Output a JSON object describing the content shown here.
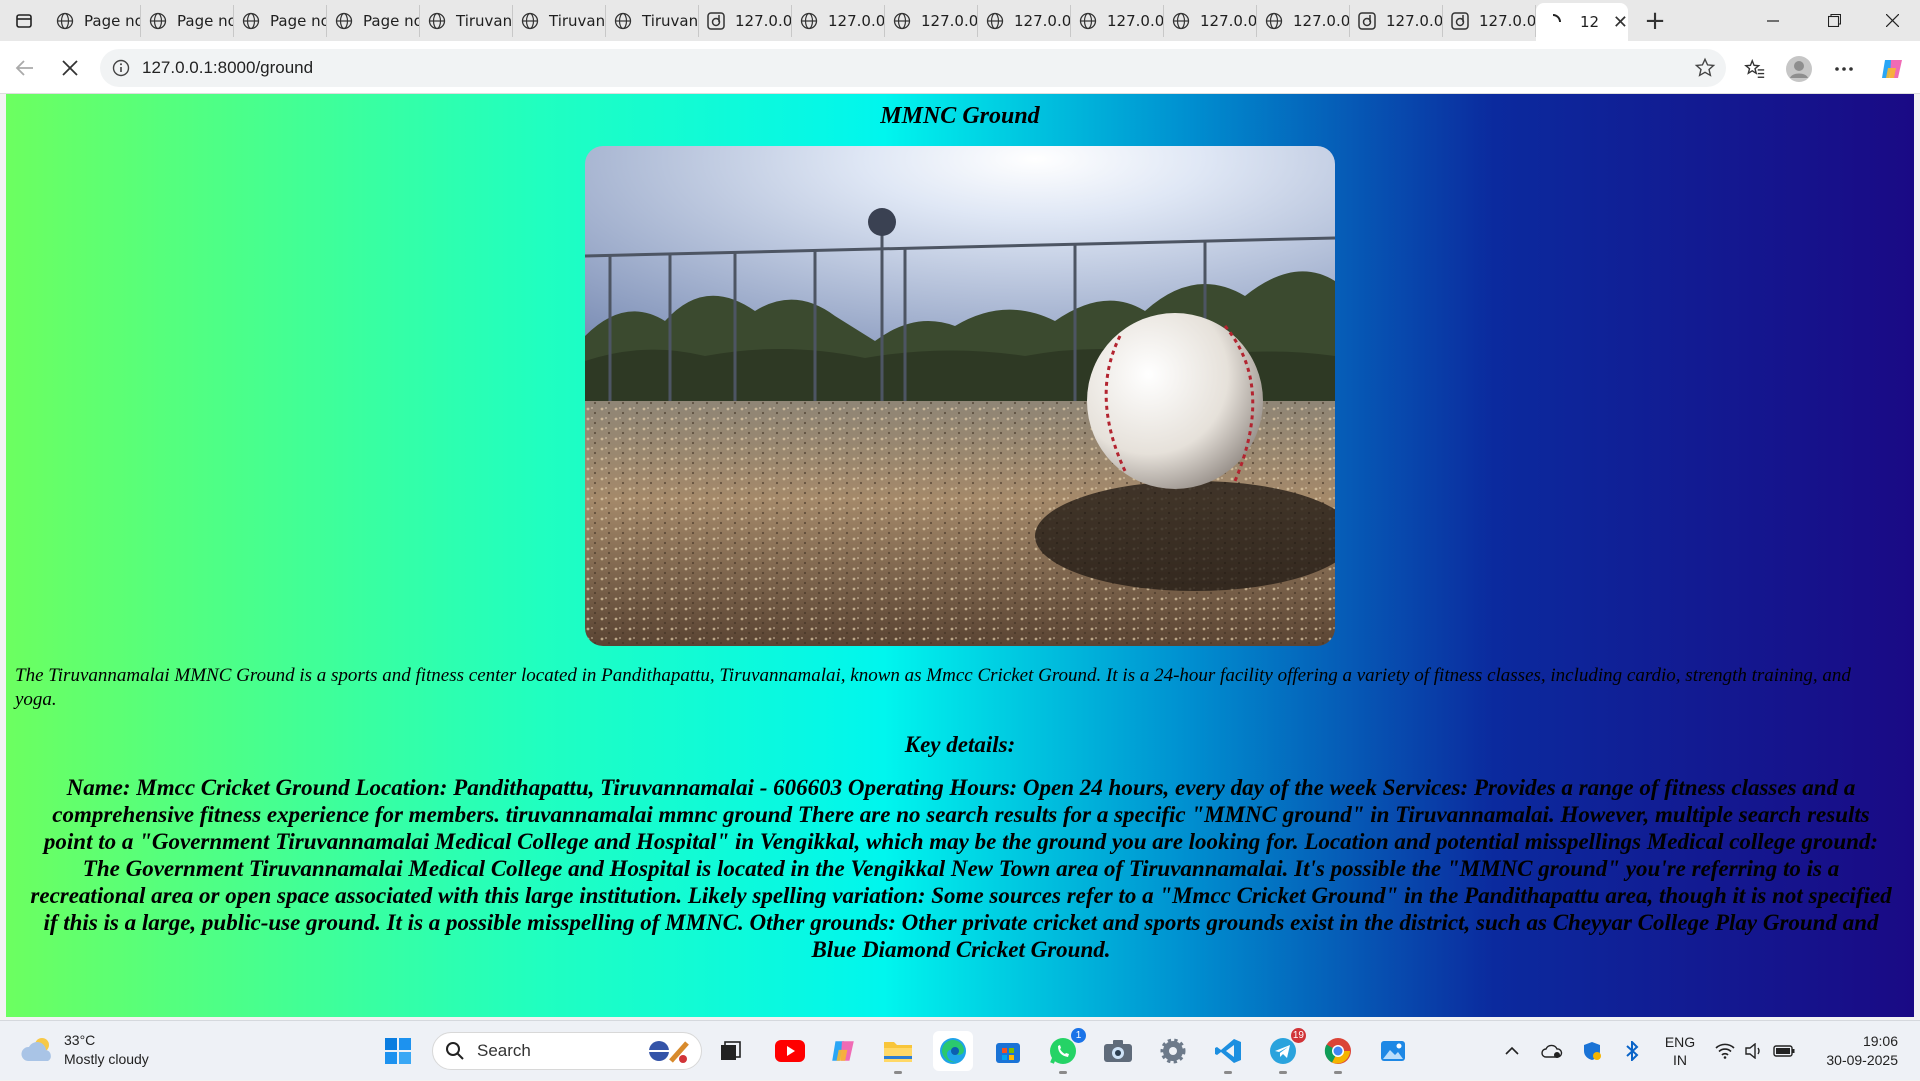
{
  "browser": {
    "tabs": [
      {
        "label": "Page not found",
        "icon": "globe-icon"
      },
      {
        "label": "Page not found",
        "icon": "globe-icon"
      },
      {
        "label": "Page not found",
        "icon": "globe-icon"
      },
      {
        "label": "Page not found",
        "icon": "globe-icon"
      },
      {
        "label": "Tiruvannamalai",
        "icon": "globe-icon"
      },
      {
        "label": "Tiruvannamalai",
        "icon": "globe-icon"
      },
      {
        "label": "Tiruvannamalai",
        "icon": "globe-icon"
      },
      {
        "label": "127.0.0.1",
        "icon": "django-icon"
      },
      {
        "label": "127.0.0.1",
        "icon": "globe-icon"
      },
      {
        "label": "127.0.0.1",
        "icon": "globe-icon"
      },
      {
        "label": "127.0.0.1",
        "icon": "globe-icon"
      },
      {
        "label": "127.0.0.1",
        "icon": "globe-icon"
      },
      {
        "label": "127.0.0.1",
        "icon": "globe-icon"
      },
      {
        "label": "127.0.0.1",
        "icon": "globe-icon"
      },
      {
        "label": "127.0.0.1",
        "icon": "django-icon"
      },
      {
        "label": "127.0.0.1",
        "icon": "django-icon"
      }
    ],
    "active_tab": {
      "label": "12",
      "icon": "loading-spinner-icon"
    },
    "address": "127.0.0.1:8000/ground"
  },
  "page": {
    "title": "MMNC Ground",
    "intro": "The Tiruvannamalai MMNC Ground is a sports and fitness center located in Pandithapattu, Tiruvannamalai, known as Mmcc Cricket Ground. It is a 24-hour facility offering a variety of fitness classes, including cardio, strength training, and yoga.",
    "key_details_heading": "Key details:",
    "key_details_body": "Name: Mmcc Cricket Ground Location: Pandithapattu, Tiruvannamalai - 606603 Operating Hours: Open 24 hours, every day of the week Services: Provides a range of fitness classes and a comprehensive fitness experience for members. tiruvannamalai mmnc ground There are no search results for a specific \"MMNC ground\" in Tiruvannamalai. However, multiple search results point to a \"Government Tiruvannamalai Medical College and Hospital\" in Vengikkal, which may be the ground you are looking for. Location and potential misspellings Medical college ground: The Government Tiruvannamalai Medical College and Hospital is located in the Vengikkal New Town area of Tiruvannamalai. It's possible the \"MMNC ground\" you're referring to is a recreational area or open space associated with this large institution. Likely spelling variation: Some sources refer to a \"Mmcc Cricket Ground\" in the Pandithapattu area, though it is not specified if this is a large, public-use ground. It is a possible misspelling of MMNC. Other grounds: Other private cricket and sports grounds exist in the district, such as Cheyyar College Play Ground and Blue Diamond Cricket Ground."
  },
  "taskbar": {
    "weather_temp": "33°C",
    "weather_desc": "Mostly cloudy",
    "search_placeholder": "Search",
    "whatsapp_badge": "1",
    "telegram_badge": "19",
    "lang_top": "ENG",
    "lang_bottom": "IN",
    "time": "19:06",
    "date": "30-09-2025"
  },
  "colors": {
    "gradient_start": "#6cff60",
    "gradient_mid": "#00f6ee",
    "gradient_end": "#1a0a85",
    "accent": "#0067c0"
  }
}
